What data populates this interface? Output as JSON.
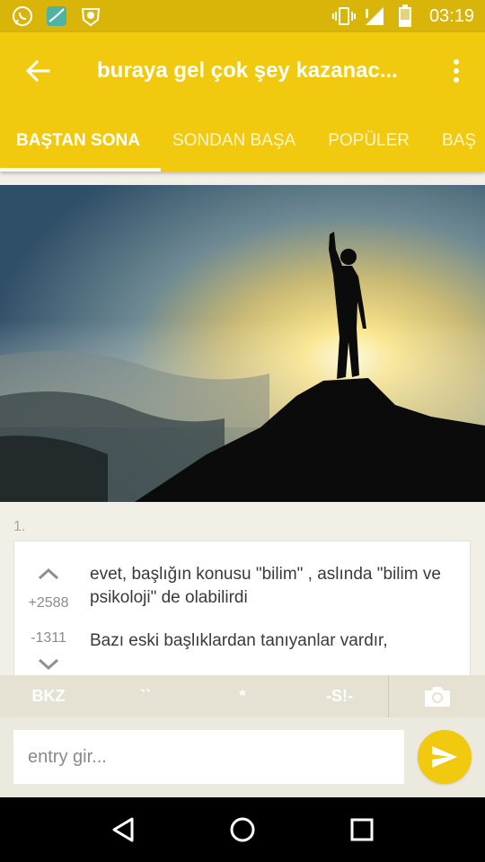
{
  "status_bar": {
    "time": "03:19",
    "left_icons": [
      "whatsapp-icon",
      "app-icon",
      "lion-app-icon"
    ],
    "right_icons": [
      "vibrate-icon",
      "signal-icon",
      "battery-icon"
    ]
  },
  "app_bar": {
    "title": "buraya gel çok şey kazanac...",
    "tabs": [
      {
        "label": "BAŞTAN SONA",
        "active": true
      },
      {
        "label": "SONDAN BAŞA",
        "active": false
      },
      {
        "label": "POPÜLER",
        "active": false
      },
      {
        "label": "BAŞ",
        "active": false
      }
    ]
  },
  "entry": {
    "index": "1.",
    "up_count": "+2588",
    "down_count": "-1311",
    "paragraphs": [
      "evet, başlığın konusu \"bilim\" , aslında \"bilim ve psikoloji\" de olabilirdi",
      "Bazı eski başlıklardan tanıyanlar vardır,"
    ]
  },
  "format_bar": {
    "buttons": [
      "BKZ",
      "``",
      "*",
      "-S!-"
    ]
  },
  "input": {
    "placeholder": "entry gir..."
  },
  "colors": {
    "accent": "#f1c90e",
    "status_bar": "#d9b50a",
    "background": "#f2efe6"
  }
}
